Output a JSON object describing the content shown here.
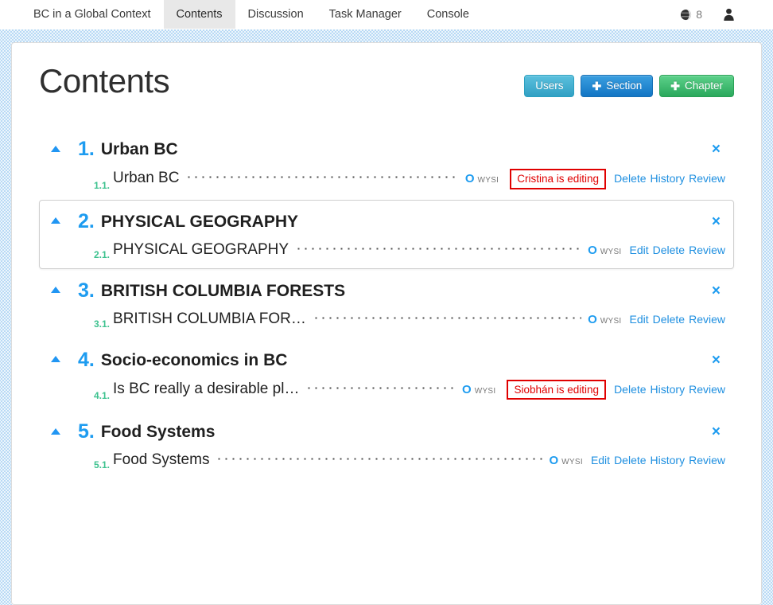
{
  "tabs": [
    {
      "label": "BC in a Global Context",
      "active": false
    },
    {
      "label": "Contents",
      "active": true
    },
    {
      "label": "Discussion",
      "active": false
    },
    {
      "label": "Task Manager",
      "active": false
    },
    {
      "label": "Console",
      "active": false
    }
  ],
  "topbar": {
    "globe_icon": "globe-icon",
    "globe_count": "8",
    "user_icon": "user-avatar-icon"
  },
  "header": {
    "title": "Contents",
    "buttons": [
      {
        "label": "Users",
        "icon": null,
        "style": "users"
      },
      {
        "label": "Section",
        "icon": "plus-icon",
        "style": "section"
      },
      {
        "label": "Chapter",
        "icon": "plus-icon",
        "style": "chapter"
      }
    ]
  },
  "colors": {
    "accent_blue": "#1e9cf0",
    "link_blue": "#1e8fe0",
    "section_green": "#3ec28f",
    "editing_red": "#e00000",
    "btn_users": "#31a0c4",
    "btn_section": "#1275c4",
    "btn_chapter": "#2aa85c",
    "page_background": "#b8d9f5"
  },
  "wysi": {
    "o_glyph": "O",
    "label": "WYSI"
  },
  "close_glyph": "×",
  "plus_glyph": "✚",
  "chapters": [
    {
      "number": "1.",
      "title": "Urban BC",
      "hovered": false,
      "close_label": "close-chapter",
      "sections": [
        {
          "number": "1.1.",
          "title": "Urban BC",
          "editing": "Cristina is editing",
          "links": [
            "Delete",
            "History",
            "Review"
          ]
        }
      ]
    },
    {
      "number": "2.",
      "title": "PHYSICAL GEOGRAPHY",
      "hovered": true,
      "close_label": "close-chapter",
      "sections": [
        {
          "number": "2.1.",
          "title": "PHYSICAL GEOGRAPHY",
          "editing": null,
          "links": [
            "Edit",
            "Delete",
            "Review"
          ]
        }
      ]
    },
    {
      "number": "3.",
      "title": "BRITISH COLUMBIA FORESTS",
      "hovered": false,
      "close_label": "close-chapter",
      "sections": [
        {
          "number": "3.1.",
          "title": "BRITISH COLUMBIA FOR…",
          "editing": null,
          "links": [
            "Edit",
            "Delete",
            "Review"
          ]
        }
      ]
    },
    {
      "number": "4.",
      "title": "Socio-economics in BC",
      "hovered": false,
      "close_label": "close-chapter",
      "sections": [
        {
          "number": "4.1.",
          "title": "Is BC really a desirable pl…",
          "editing": "Siobhán is editing",
          "links": [
            "Delete",
            "History",
            "Review"
          ]
        }
      ]
    },
    {
      "number": "5.",
      "title": "Food Systems",
      "hovered": false,
      "close_label": "close-chapter",
      "sections": [
        {
          "number": "5.1.",
          "title": "Food Systems",
          "editing": null,
          "links": [
            "Edit",
            "Delete",
            "History",
            "Review"
          ]
        }
      ]
    }
  ]
}
